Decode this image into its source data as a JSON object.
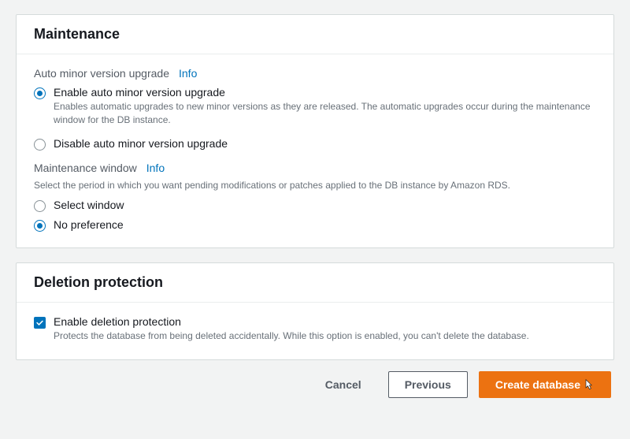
{
  "maintenance": {
    "title": "Maintenance",
    "auto_upgrade": {
      "label": "Auto minor version upgrade",
      "info": "Info",
      "enable": {
        "label": "Enable auto minor version upgrade",
        "desc": "Enables automatic upgrades to new minor versions as they are released. The automatic upgrades occur during the maintenance window for the DB instance."
      },
      "disable": {
        "label": "Disable auto minor version upgrade"
      },
      "selected": "enable"
    },
    "window": {
      "label": "Maintenance window",
      "info": "Info",
      "desc": "Select the period in which you want pending modifications or patches applied to the DB instance by Amazon RDS.",
      "select": {
        "label": "Select window"
      },
      "no_pref": {
        "label": "No preference"
      },
      "selected": "no_pref"
    }
  },
  "deletion": {
    "title": "Deletion protection",
    "enable": {
      "label": "Enable deletion protection",
      "desc": "Protects the database from being deleted accidentally. While this option is enabled, you can't delete the database.",
      "checked": true
    }
  },
  "footer": {
    "cancel": "Cancel",
    "previous": "Previous",
    "create": "Create database"
  }
}
